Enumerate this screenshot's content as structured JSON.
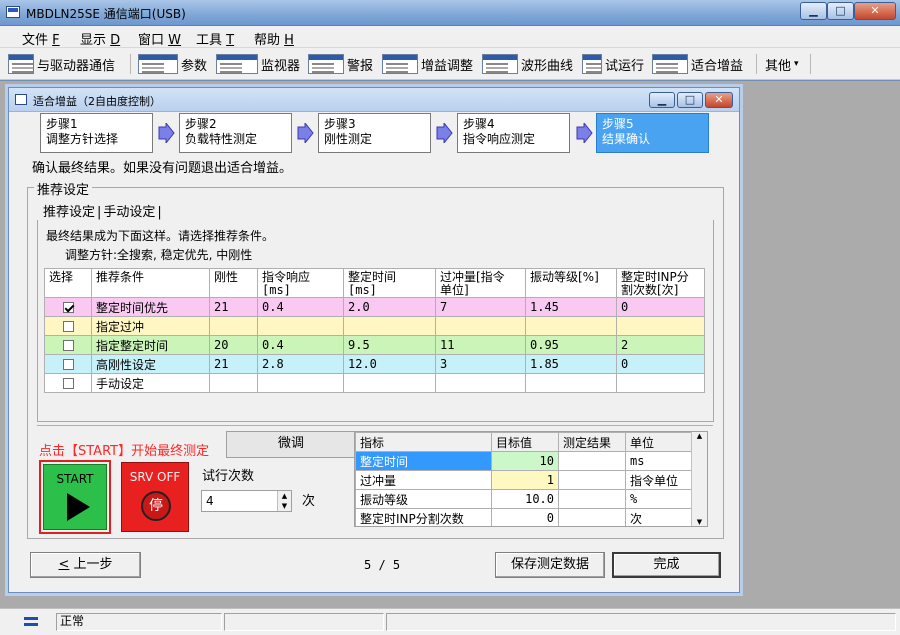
{
  "app": {
    "title": "MBDLN25SE  通信端口(USB)"
  },
  "menu": [
    {
      "label": "文件",
      "key": "F"
    },
    {
      "label": "显示",
      "key": "D"
    },
    {
      "label": "窗口",
      "key": "W"
    },
    {
      "label": "工具",
      "key": "T"
    },
    {
      "label": "帮助",
      "key": "H"
    }
  ],
  "toolbar": {
    "items": [
      "与驱动器通信",
      "参数",
      "监视器",
      "警报",
      "增益调整",
      "波形曲线",
      "试运行",
      "适合增益"
    ],
    "more": "其他"
  },
  "dialog": {
    "title": "适合增益（2自由度控制）"
  },
  "steps": [
    {
      "line1": "步骤1",
      "line2": "调整方针选择"
    },
    {
      "line1": "步骤2",
      "line2": "负载特性测定"
    },
    {
      "line1": "步骤3",
      "line2": "刚性测定"
    },
    {
      "line1": "步骤4",
      "line2": "指令响应测定"
    },
    {
      "line1": "步骤5",
      "line2": "结果确认"
    }
  ],
  "confirm_text": "确认最终结果。如果没有问题退出适合增益。",
  "group_label": "推荐设定",
  "tabs": [
    "推荐设定",
    "手动设定"
  ],
  "info": {
    "line1": "最终结果成为下面这样。请选择推荐条件。",
    "line2": "调整方针:全搜索, 稳定优先, 中刚性"
  },
  "rec_table": {
    "headers": [
      "选择",
      "推荐条件",
      "刚性",
      "指令响应\n[ms]",
      "整定时间\n[ms]",
      "过冲量[指令\n单位]",
      "振动等级[%]",
      "整定时INP分\n割次数[次]"
    ],
    "rows": [
      {
        "checked": true,
        "cond": "整定时间优先",
        "rigidity": "21",
        "cmd": "0.4",
        "settle": "2.0",
        "overshoot": "7",
        "vib": "1.45",
        "inp": "0",
        "color": "#f9c9f2"
      },
      {
        "checked": false,
        "cond": "指定过冲",
        "rigidity": "",
        "cmd": "",
        "settle": "",
        "overshoot": "",
        "vib": "",
        "inp": "",
        "color": "#fff6c4"
      },
      {
        "checked": false,
        "cond": "指定整定时间",
        "rigidity": "20",
        "cmd": "0.4",
        "settle": "9.5",
        "overshoot": "11",
        "vib": "0.95",
        "inp": "2",
        "color": "#cbf5b8"
      },
      {
        "checked": false,
        "cond": "高刚性设定",
        "rigidity": "21",
        "cmd": "2.8",
        "settle": "12.0",
        "overshoot": "3",
        "vib": "1.85",
        "inp": "0",
        "color": "#c7f1f8"
      },
      {
        "checked": false,
        "cond": "手动设定",
        "rigidity": "",
        "cmd": "",
        "settle": "",
        "overshoot": "",
        "vib": "",
        "inp": "",
        "color": "#ffffff"
      }
    ]
  },
  "hint": "点击【START】开始最终测定",
  "fine_tune": "微调",
  "start_label": "START",
  "srv_off_label": "SRV OFF",
  "stop_glyph": "停",
  "trial": {
    "label": "试行次数",
    "value": "4",
    "unit": "次"
  },
  "metric_table": {
    "headers": [
      "指标",
      "目标值",
      "测定结果",
      "单位"
    ],
    "rows": [
      {
        "name": "整定时间",
        "target": "10",
        "result": "",
        "unit": "ms"
      },
      {
        "name": "过冲量",
        "target": "1",
        "result": "",
        "unit": "指令单位"
      },
      {
        "name": "振动等级",
        "target": "10.0",
        "result": "",
        "unit": "%"
      },
      {
        "name": "整定时INP分割次数",
        "target": "0",
        "result": "",
        "unit": "次"
      }
    ]
  },
  "nav": {
    "prev": "上一步",
    "prev_key": "<",
    "page": "5 / 5",
    "save": "保存测定数据",
    "finish": "完成"
  },
  "status": {
    "text": "正常"
  }
}
